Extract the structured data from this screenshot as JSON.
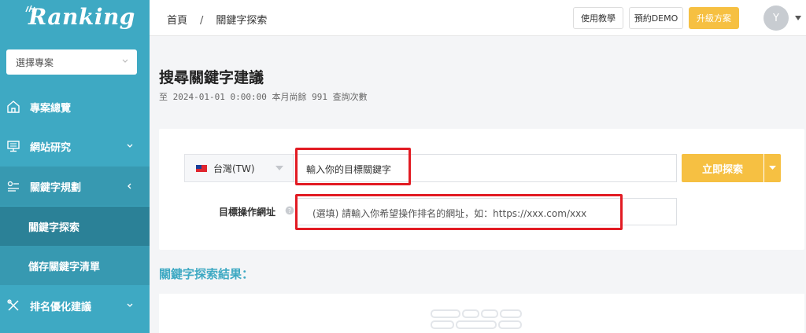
{
  "sidebar": {
    "logo": "Ranking",
    "project_select": "選擇專案",
    "items": [
      {
        "label": "專案總覽"
      },
      {
        "label": "網站研究"
      },
      {
        "label": "關鍵字規劃"
      },
      {
        "label": "關鍵字探索"
      },
      {
        "label": "儲存關鍵字清單"
      },
      {
        "label": "排名優化建議"
      }
    ]
  },
  "topbar": {
    "breadcrumb": [
      "首頁",
      "/",
      "關鍵字探索"
    ],
    "tutorial_label": "使用教學",
    "demo_label": "預約DEMO",
    "upgrade_label": "升級方案",
    "avatar_initial": "Y"
  },
  "main": {
    "title": "搜尋關鍵字建議",
    "quota_text": "至 2024-01-01 0:00:00 本月尚餘 991 查詢次數",
    "country": "台灣(TW)",
    "keyword_placeholder": "輸入你的目標關鍵字",
    "search_label": "立即探索",
    "url_label": "目標操作網址",
    "url_placeholder": "(選填) 請輸入你希望操作排名的網址，如：https://xxx.com/xxx",
    "results_title": "關鍵字探索結果："
  },
  "colors": {
    "sidebar": "#3ea9c3",
    "accent": "#f6c042",
    "highlight": "#e21b23"
  }
}
